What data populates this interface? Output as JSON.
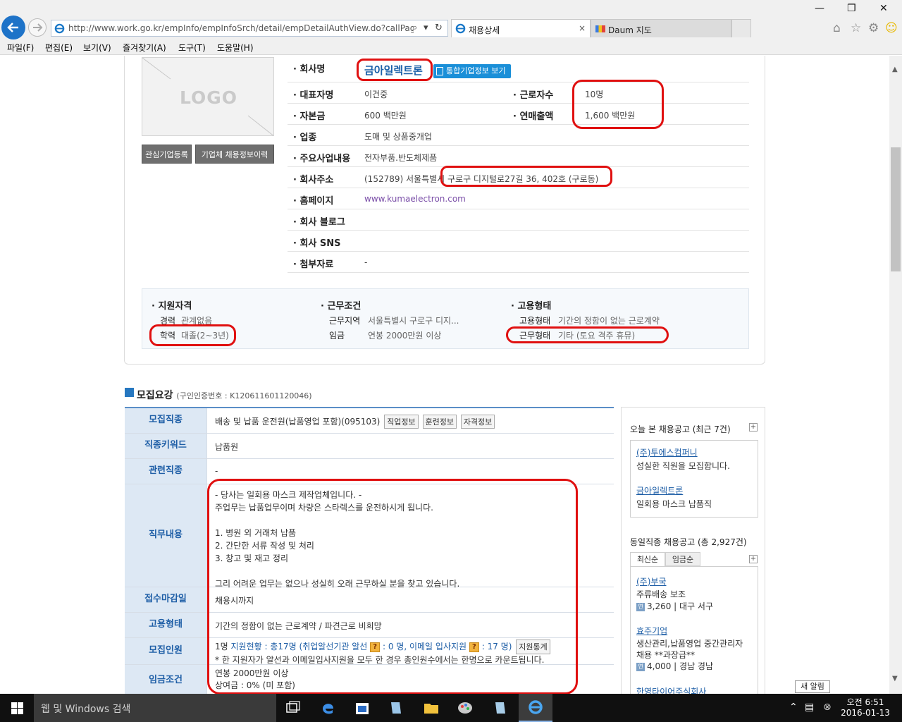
{
  "browser": {
    "address": "http://www.work.go.kr/empInfo/empInfoSrch/detail/empDetailAuthView.do?callPage=det",
    "tabs": [
      {
        "label": "채용상세",
        "close": "×"
      },
      {
        "label": "Daum 지도"
      }
    ],
    "menu": [
      "파일(F)",
      "편집(E)",
      "보기(V)",
      "즐겨찾기(A)",
      "도구(T)",
      "도움말(H)"
    ]
  },
  "company": {
    "logo_placeholder": "LOGO",
    "btn_interest": "관심기업등록",
    "btn_recruit_info": "기업체 채용정보이력",
    "name_label": "· 회사명",
    "name": "금아일렉트론",
    "integrated_btn": "통합기업정보 보기",
    "rows": {
      "ceo_label": "· 대표자명",
      "ceo": "이건중",
      "workers_label": "· 근로자수",
      "workers": "10명",
      "capital_label": "· 자본금",
      "capital": "600 백만원",
      "sales_label": "· 연매출액",
      "sales": "1,600 백만원",
      "industry_label": "· 업종",
      "industry": "도매 및 상품중개업",
      "business_label": "· 주요사업내용",
      "business": "전자부품.반도체제품",
      "address_label": "· 회사주소",
      "address": "(152789) 서울특별시 구로구 디지털로27길 36, 402호 (구로동)",
      "homepage_label": "· 홈페이지",
      "homepage": "www.kumaelectron.com",
      "blog_label": "· 회사 블로그",
      "sns_label": "· 회사 SNS",
      "attach_label": "· 첨부자료",
      "attach": "-"
    }
  },
  "summary": {
    "qual_head": "· 지원자격",
    "career_key": "경력",
    "career_val": "관계없음",
    "edu_key": "학력",
    "edu_val": "대졸(2~3년)",
    "cond_head": "· 근무조건",
    "area_key": "근무지역",
    "area_val": "서울특별시 구로구 디지...",
    "wage_key": "임금",
    "wage_val": "연봉 2000만원 이상",
    "emp_head": "· 고용형태",
    "emptype_key": "고용형태",
    "emptype_val": "기간의 정함이 없는 근로계약",
    "worktype_key": "근무형태",
    "worktype_val": "기타 (토요 격주 휴뮤)"
  },
  "recruit": {
    "title": "모집요강",
    "cert_no": "(구인인증번호 : K120611601120046)",
    "rows": {
      "job_head": "모집직종",
      "job": "배송 및 납품 운전원(납품영업 포함)(095103)",
      "job_btns": [
        "직업정보",
        "훈련정보",
        "자격정보"
      ],
      "keyword_head": "직종키워드",
      "keyword": "납품원",
      "related_head": "관련직종",
      "related": "-",
      "duty_head": "직무내용",
      "duty_lines": [
        "- 당사는 일회용 마스크 제작업체입니다. -",
        "주업무는 납품업무이며 차량은 스타렉스를 운전하시게 됩니다.",
        "",
        "1. 병원 외 거래처 납품",
        "2. 간단한 서류 작성 및 처리",
        "3. 창고 및 재고 정리",
        "",
        "그리 어려운 업무는 없으나 성실히 오래 근무하실 분을 찾고 있습니다."
      ],
      "deadline_head": "접수마감일",
      "deadline": "채용시까지",
      "emptype_head": "고용형태",
      "emptype": "기간의 정함이 없는 근로계약 / 파견근로 비희망",
      "count_head": "모집인원",
      "count_prefix": "1명",
      "count_status": "지원현황 : 총17명 (취업알선기관 알선",
      "count_mid": ": 0 명, 이메일 입사지원",
      "count_end": ": 17 명)",
      "count_btn": "지원통계",
      "count_note": "* 한 지원자가 알선과 이메일입사지원을 모두 한 경우 총인원수에서는 한명으로 카운트됩니다.",
      "wage_head": "임금조건",
      "wage": "연봉 2000만원 이상",
      "bonus": "상여금 : 0% (미 포함)"
    }
  },
  "side": {
    "recent_title": "오늘 본 채용공고 (최근 7건)",
    "recent": [
      {
        "company": "(주)투에스컴퍼니",
        "title": "성실한 직원을 모집합니다."
      },
      {
        "company": "금아일렉트론",
        "title": "일회용 마스크 납품직"
      }
    ],
    "same_title": "동일직종 채용공고 (총 2,927건)",
    "tab_latest": "최신순",
    "tab_wage": "임금순",
    "jobs": [
      {
        "company": "(주)부국",
        "title": "주류배송 보조",
        "info": "3,260  |  대구 서구"
      },
      {
        "company": "효주기업",
        "title": "생산관리,납품영업 중간관리자",
        "title2": "채용 **과장급**",
        "info": "4,000  |  경남 경남"
      },
      {
        "company": "한영타이어주식회사"
      }
    ],
    "new_alert": "새 알림"
  },
  "taskbar": {
    "search_placeholder": "웹 및 Windows 검색",
    "time": "오전 6:51",
    "date": "2016-01-13"
  }
}
